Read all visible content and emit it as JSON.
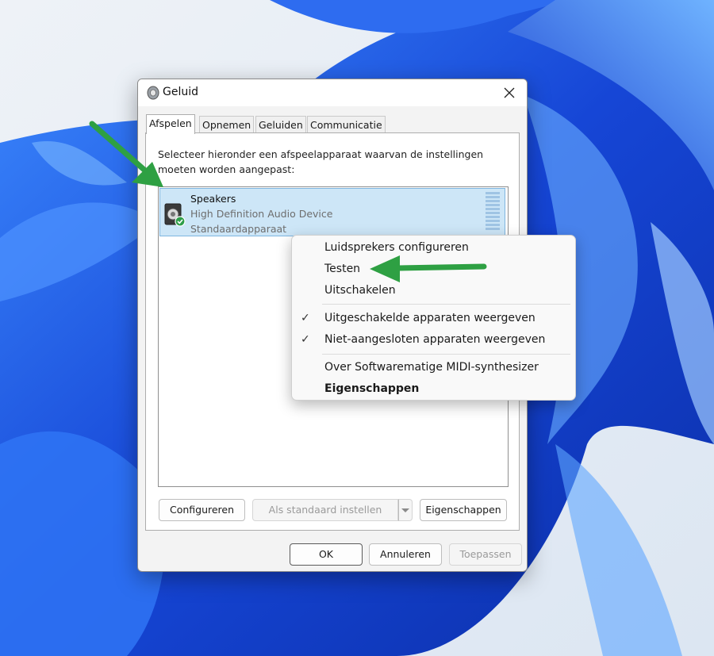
{
  "dialog": {
    "title": "Geluid",
    "tabs": [
      "Afspelen",
      "Opnemen",
      "Geluiden",
      "Communicatie"
    ],
    "instructions": "Selecteer hieronder een afspeelapparaat waarvan de instellingen moeten worden aangepast:",
    "device": {
      "name": "Speakers",
      "description": "High Definition Audio Device",
      "status": "Standaardapparaat"
    },
    "buttons": {
      "configure": "Configureren",
      "set_default": "Als standaard instellen",
      "properties": "Eigenschappen",
      "ok": "OK",
      "cancel": "Annuleren",
      "apply": "Toepassen"
    }
  },
  "context_menu": {
    "items": [
      "Luidsprekers configureren",
      "Testen",
      "Uitschakelen",
      "Uitgeschakelde apparaten weergeven",
      "Niet-aangesloten apparaten weergeven",
      "Over Softwarematige MIDI-synthesizer",
      "Eigenschappen"
    ],
    "checked": [
      false,
      false,
      false,
      true,
      true,
      false,
      false
    ]
  },
  "colors": {
    "selection": "#cde6f7",
    "annotation_arrow": "#2ea043",
    "wallpaper": "#1f4fd8"
  }
}
